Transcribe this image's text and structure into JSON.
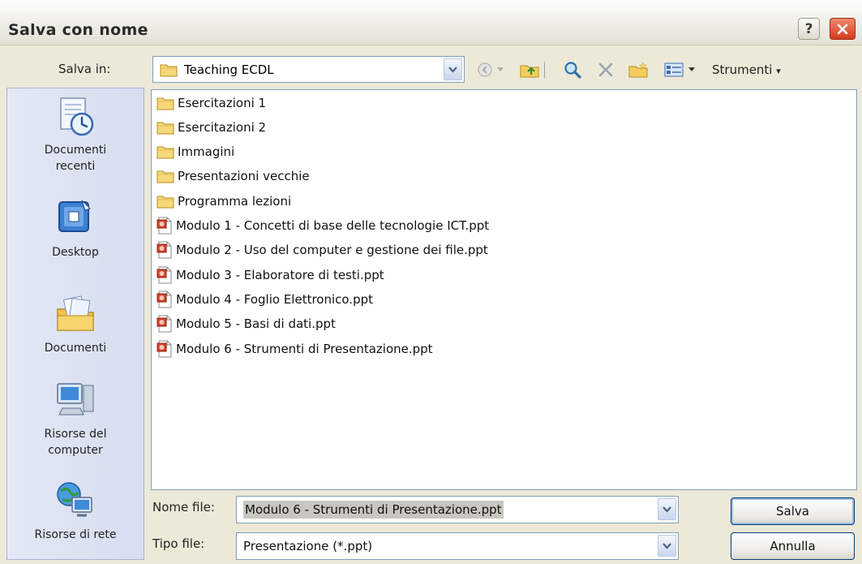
{
  "window": {
    "title": "Salva con nome"
  },
  "toolbar": {
    "save_in_label": "Salva in:",
    "folder_value": "Teaching ECDL",
    "tools_label": "Strumenti"
  },
  "places": [
    {
      "label_line1": "Documenti",
      "label_line2": "recenti",
      "icon": "recent-documents-icon"
    },
    {
      "label_line1": "Desktop",
      "label_line2": "",
      "icon": "desktop-icon"
    },
    {
      "label_line1": "Documenti",
      "label_line2": "",
      "icon": "my-documents-icon"
    },
    {
      "label_line1": "Risorse del",
      "label_line2": "computer",
      "icon": "my-computer-icon"
    },
    {
      "label_line1": "Risorse di rete",
      "label_line2": "",
      "icon": "network-icon"
    }
  ],
  "files": [
    {
      "name": "Esercitazioni 1",
      "type": "folder"
    },
    {
      "name": "Esercitazioni 2",
      "type": "folder"
    },
    {
      "name": "Immagini",
      "type": "folder"
    },
    {
      "name": "Presentazioni vecchie",
      "type": "folder"
    },
    {
      "name": "Programma lezioni",
      "type": "folder"
    },
    {
      "name": "Modulo 1 - Concetti di base delle tecnologie ICT.ppt",
      "type": "ppt"
    },
    {
      "name": "Modulo 2 - Uso del computer e gestione dei file.ppt",
      "type": "ppt"
    },
    {
      "name": "Modulo 3 - Elaboratore di testi.ppt",
      "type": "ppt"
    },
    {
      "name": "Modulo 4 - Foglio Elettronico.ppt",
      "type": "ppt"
    },
    {
      "name": "Modulo 5 - Basi di dati.ppt",
      "type": "ppt"
    },
    {
      "name": "Modulo 6 - Strumenti di Presentazione.ppt",
      "type": "ppt"
    }
  ],
  "form": {
    "filename_label": "Nome file:",
    "filename_value": "Modulo 6 - Strumenti di Presentazione.ppt",
    "filetype_label": "Tipo file:",
    "filetype_value": "Presentazione (*.ppt)",
    "save_button": "Salva",
    "cancel_button": "Annulla"
  },
  "colors": {
    "dialog_bg": "#ece9d8",
    "field_border": "#7f9db9",
    "close_red": "#d6391c"
  }
}
